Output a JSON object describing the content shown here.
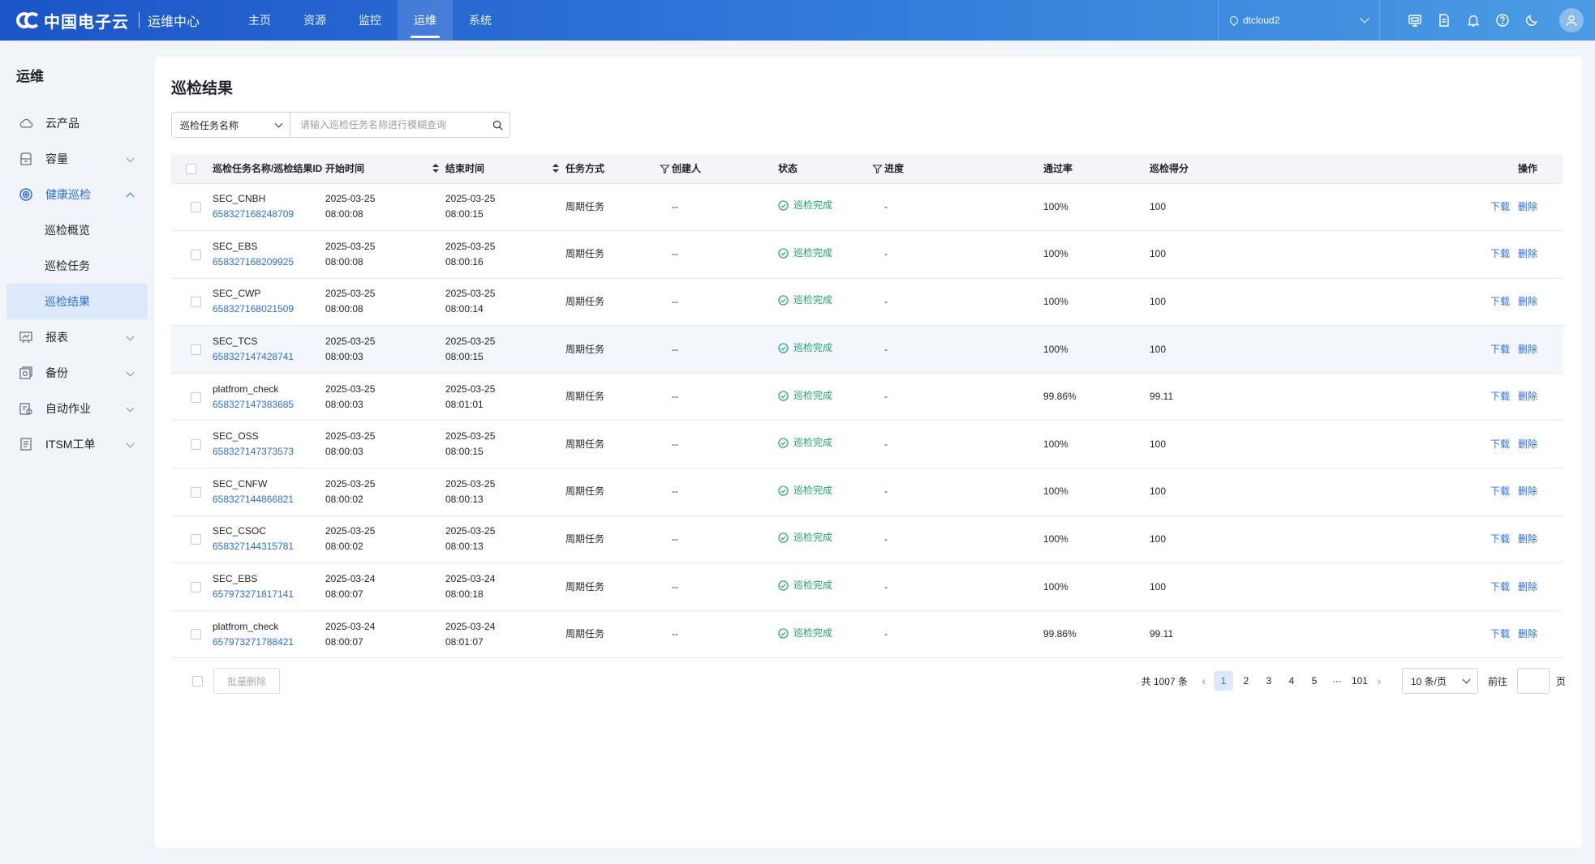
{
  "header": {
    "brand": "中国电子云",
    "product": "运维中心",
    "nav": [
      "主页",
      "资源",
      "监控",
      "运维",
      "系统"
    ],
    "active_nav": 3,
    "region": "dtcloud2",
    "icons": [
      "screen-icon",
      "document-icon",
      "bell-icon",
      "help-icon",
      "moon-icon",
      "user-icon"
    ]
  },
  "sidebar": {
    "title": "运维",
    "items": [
      {
        "label": "云产品",
        "icon": "cloud-icon",
        "expandable": false
      },
      {
        "label": "容量",
        "icon": "storage-icon",
        "expandable": true
      },
      {
        "label": "健康巡检",
        "icon": "target-icon",
        "expandable": true,
        "open": true,
        "children": [
          "巡检概览",
          "巡检任务",
          "巡检结果"
        ],
        "active_child": 2
      },
      {
        "label": "报表",
        "icon": "report-icon",
        "expandable": true
      },
      {
        "label": "备份",
        "icon": "backup-icon",
        "expandable": true
      },
      {
        "label": "自动作业",
        "icon": "automation-icon",
        "expandable": true
      },
      {
        "label": "ITSM工单",
        "icon": "ticket-icon",
        "expandable": true
      }
    ]
  },
  "main": {
    "title": "巡检结果",
    "filter": {
      "field": "巡检任务名称",
      "placeholder": "请输入巡检任务名称进行模糊查询",
      "value": ""
    },
    "columns": [
      "巡检任务名称/巡检结果ID",
      "开始时间",
      "结束时间",
      "任务方式",
      "创建人",
      "状态",
      "进度",
      "通过率",
      "巡检得分",
      "操作"
    ],
    "rows": [
      {
        "name": "SEC_CNBH",
        "id": "658327168248709",
        "start_date": "2025-03-25",
        "start_time": "08:00:08",
        "end_date": "2025-03-25",
        "end_time": "08:00:15",
        "mode": "周期任务",
        "creator": "--",
        "status": "巡检完成",
        "progress": "-",
        "pass_rate": "100%",
        "score": "100"
      },
      {
        "name": "SEC_EBS",
        "id": "658327168209925",
        "start_date": "2025-03-25",
        "start_time": "08:00:08",
        "end_date": "2025-03-25",
        "end_time": "08:00:16",
        "mode": "周期任务",
        "creator": "--",
        "status": "巡检完成",
        "progress": "-",
        "pass_rate": "100%",
        "score": "100"
      },
      {
        "name": "SEC_CWP",
        "id": "658327168021509",
        "start_date": "2025-03-25",
        "start_time": "08:00:08",
        "end_date": "2025-03-25",
        "end_time": "08:00:14",
        "mode": "周期任务",
        "creator": "--",
        "status": "巡检完成",
        "progress": "-",
        "pass_rate": "100%",
        "score": "100"
      },
      {
        "name": "SEC_TCS",
        "id": "658327147428741",
        "start_date": "2025-03-25",
        "start_time": "08:00:03",
        "end_date": "2025-03-25",
        "end_time": "08:00:15",
        "mode": "周期任务",
        "creator": "--",
        "status": "巡检完成",
        "progress": "-",
        "pass_rate": "100%",
        "score": "100"
      },
      {
        "name": "platfrom_check",
        "id": "658327147383685",
        "start_date": "2025-03-25",
        "start_time": "08:00:03",
        "end_date": "2025-03-25",
        "end_time": "08:01:01",
        "mode": "周期任务",
        "creator": "--",
        "status": "巡检完成",
        "progress": "-",
        "pass_rate": "99.86%",
        "score": "99.11"
      },
      {
        "name": "SEC_OSS",
        "id": "658327147373573",
        "start_date": "2025-03-25",
        "start_time": "08:00:03",
        "end_date": "2025-03-25",
        "end_time": "08:00:15",
        "mode": "周期任务",
        "creator": "--",
        "status": "巡检完成",
        "progress": "-",
        "pass_rate": "100%",
        "score": "100"
      },
      {
        "name": "SEC_CNFW",
        "id": "658327144866821",
        "start_date": "2025-03-25",
        "start_time": "08:00:02",
        "end_date": "2025-03-25",
        "end_time": "08:00:13",
        "mode": "周期任务",
        "creator": "--",
        "status": "巡检完成",
        "progress": "-",
        "pass_rate": "100%",
        "score": "100"
      },
      {
        "name": "SEC_CSOC",
        "id": "658327144315781",
        "start_date": "2025-03-25",
        "start_time": "08:00:02",
        "end_date": "2025-03-25",
        "end_time": "08:00:13",
        "mode": "周期任务",
        "creator": "--",
        "status": "巡检完成",
        "progress": "-",
        "pass_rate": "100%",
        "score": "100"
      },
      {
        "name": "SEC_EBS",
        "id": "657973271817141",
        "start_date": "2025-03-24",
        "start_time": "08:00:07",
        "end_date": "2025-03-24",
        "end_time": "08:00:18",
        "mode": "周期任务",
        "creator": "--",
        "status": "巡检完成",
        "progress": "-",
        "pass_rate": "100%",
        "score": "100"
      },
      {
        "name": "platfrom_check",
        "id": "657973271788421",
        "start_date": "2025-03-24",
        "start_time": "08:00:07",
        "end_date": "2025-03-24",
        "end_time": "08:01:07",
        "mode": "周期任务",
        "creator": "--",
        "status": "巡检完成",
        "progress": "-",
        "pass_rate": "99.86%",
        "score": "99.11"
      }
    ],
    "highlighted_row": 3,
    "actions": {
      "download": "下载",
      "delete": "删除"
    },
    "batch_delete": "批量删除",
    "pagination": {
      "total": "共 1007 条",
      "pages": [
        "1",
        "2",
        "3",
        "4",
        "5",
        "···",
        "101"
      ],
      "current": "1",
      "page_size": "10 条/页",
      "goto_label": "前往",
      "goto_suffix": "页"
    },
    "colors": {
      "accent": "#2b6de0",
      "success": "#1fa56c",
      "header_start": "#1b55c8",
      "header_end": "#4a9be3"
    }
  }
}
